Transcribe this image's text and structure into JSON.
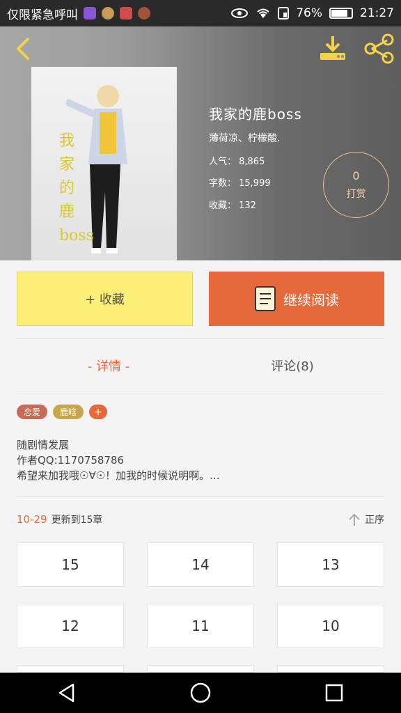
{
  "status_bar": {
    "carrier": "仅限紧急呼叫",
    "battery": "76%",
    "time": "21:27",
    "icons": [
      "eye-icon",
      "wifi-icon",
      "sim-icon",
      "battery-icon"
    ]
  },
  "header": {
    "back_icon": "back-arrow-icon",
    "download_icon": "download-icon",
    "share_icon": "share-icon"
  },
  "book": {
    "cover_text": "我家的鹿boss",
    "title": "我家的鹿boss",
    "author": "薄荷凉、柠檬酸.",
    "popularity": "人气： 8,865",
    "word_count": "字数： 15,999",
    "favorites": "收藏： 132",
    "tip_count": "0",
    "tip_label": "打赏"
  },
  "actions": {
    "favorite": "+ 收藏",
    "read": "继续阅读"
  },
  "tabs": {
    "detail": "- 详情 -",
    "comments": "评论(8)"
  },
  "tags": [
    "恋爱",
    "鹿晗",
    "+"
  ],
  "description": {
    "line1": "随剧情发展",
    "line2": "作者QQ:1170758786",
    "line3": "希望来加我哦☉∀☉！加我的时候说明啊。..."
  },
  "update": {
    "date": "10-29",
    "text": "更新到15章",
    "sort_label": "正序"
  },
  "chapters": [
    "15",
    "14",
    "13",
    "12",
    "11",
    "10"
  ],
  "colors": {
    "accent": "#e5693a",
    "favorite_bg": "#fbef77",
    "tag_love": "#c56b57",
    "tag_lu": "#c8a54d"
  }
}
